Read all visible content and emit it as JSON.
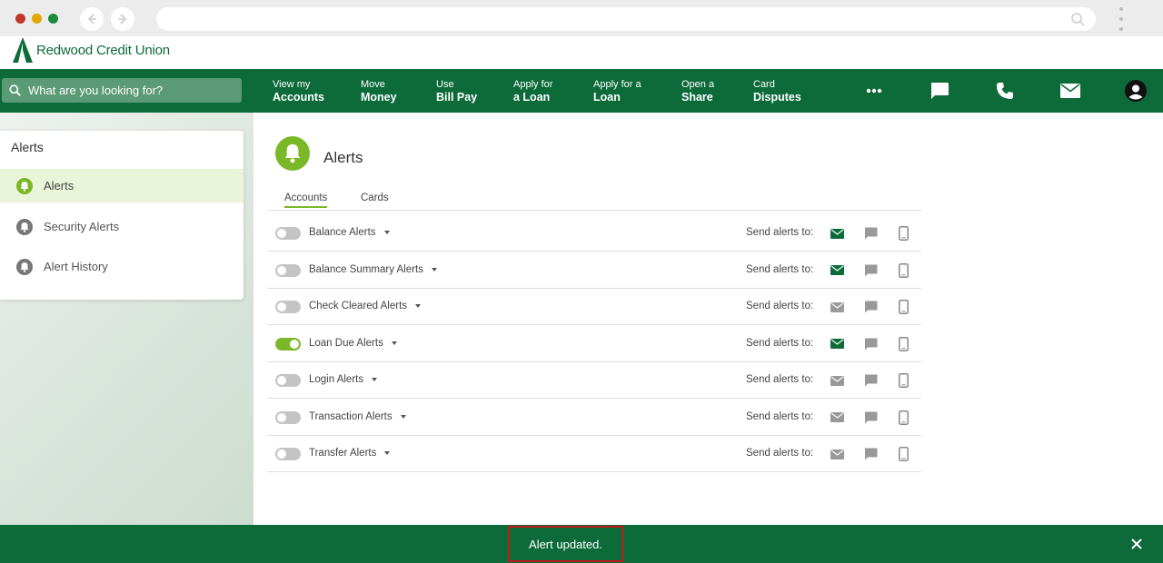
{
  "brand": {
    "name": "Redwood Credit Union",
    "color": "#0d6b3a",
    "accent": "#7ab828"
  },
  "search": {
    "placeholder": "What are you looking for?"
  },
  "nav": [
    {
      "line1": "View my",
      "line2": "Accounts"
    },
    {
      "line1": "Move",
      "line2": "Money"
    },
    {
      "line1": "Use",
      "line2": "Bill Pay"
    },
    {
      "line1": "Apply for",
      "line2": "a Loan"
    },
    {
      "line1": "Apply for a",
      "line2": "Loan"
    },
    {
      "line1": "Open a",
      "line2": "Share"
    },
    {
      "line1": "Card",
      "line2": "Disputes"
    }
  ],
  "nav_icons": [
    "more-icon",
    "chat-icon",
    "phone-icon",
    "mail-icon",
    "account-icon"
  ],
  "sidebar": {
    "title": "Alerts",
    "items": [
      {
        "label": "Alerts",
        "active": true
      },
      {
        "label": "Security Alerts",
        "active": false
      },
      {
        "label": "Alert History",
        "active": false
      }
    ]
  },
  "main": {
    "title": "Alerts",
    "tabs": [
      {
        "label": "Accounts",
        "active": true
      },
      {
        "label": "Cards",
        "active": false
      }
    ],
    "send_label": "Send alerts to:",
    "rows": [
      {
        "label": "Balance Alerts",
        "enabled": false,
        "email": true
      },
      {
        "label": "Balance Summary Alerts",
        "enabled": false,
        "email": true
      },
      {
        "label": "Check Cleared Alerts",
        "enabled": false,
        "email": false
      },
      {
        "label": "Loan Due Alerts",
        "enabled": true,
        "email": true
      },
      {
        "label": "Login Alerts",
        "enabled": false,
        "email": false
      },
      {
        "label": "Transaction Alerts",
        "enabled": false,
        "email": false
      },
      {
        "label": "Transfer Alerts",
        "enabled": false,
        "email": false
      }
    ]
  },
  "toast": {
    "message": "Alert updated."
  }
}
